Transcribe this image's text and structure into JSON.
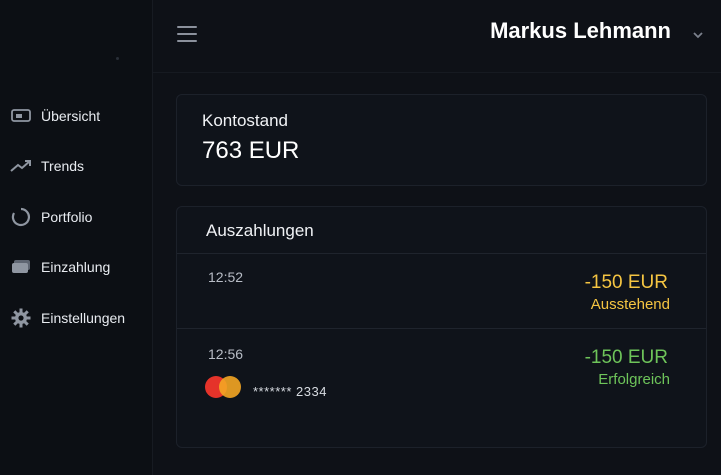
{
  "sidebar": {
    "items": [
      {
        "label": "Übersicht",
        "icon": "monitor-icon"
      },
      {
        "label": "Trends",
        "icon": "trend-up-icon"
      },
      {
        "label": "Portfolio",
        "icon": "pie-chart-icon"
      },
      {
        "label": "Einzahlung",
        "icon": "wallet-icon"
      },
      {
        "label": "Einstellungen",
        "icon": "gear-icon"
      }
    ]
  },
  "header": {
    "user_name": "Markus Lehmann",
    "menu_icon": "hamburger-icon",
    "dropdown_icon": "chevron-down-icon"
  },
  "balance": {
    "title": "Kontostand",
    "value": "763 EUR"
  },
  "payouts": {
    "title": "Auszahlungen",
    "rows": [
      {
        "time": "12:52",
        "amount": "-150 EUR",
        "status": "Ausstehend",
        "status_color": "#f5c542"
      },
      {
        "time": "12:56",
        "amount": "-150 EUR",
        "status": "Erfolgreich",
        "status_color": "#6ec45a",
        "card_masked": "******* 2334",
        "card_icon": "mastercard-icon"
      }
    ]
  },
  "colors": {
    "background": "#0e1117",
    "pending": "#f5c542",
    "success": "#6ec45a"
  }
}
